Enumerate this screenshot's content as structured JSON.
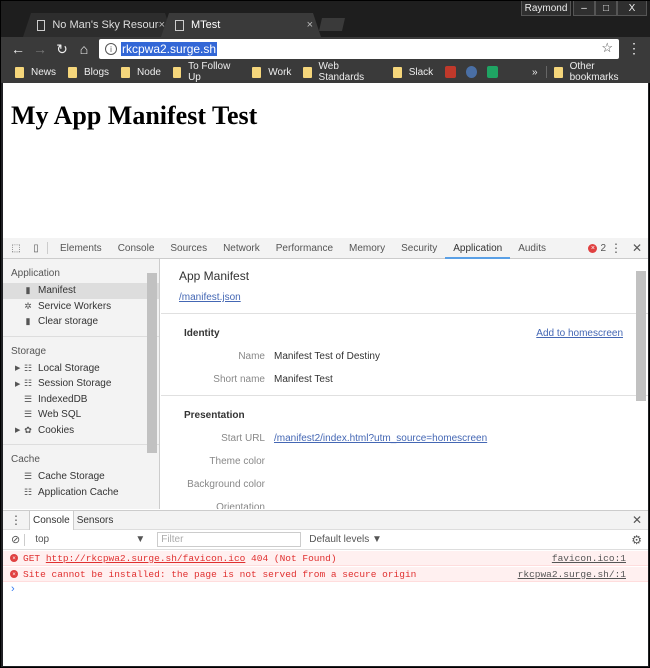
{
  "browser": {
    "tabs": [
      {
        "title": "No Man's Sky Resource",
        "active": false
      },
      {
        "title": "MTest",
        "active": true
      }
    ],
    "profile": "Raymond",
    "window_buttons": {
      "minimize": "‒",
      "maximize": "□",
      "close": "X"
    },
    "url": "rkcpwa2.surge.sh",
    "bookmarks": [
      "News",
      "Blogs",
      "Node",
      "To Follow Up",
      "Work",
      "Web Standards",
      "Slack"
    ],
    "bookmark_icons": [
      {
        "name": "wu-icon",
        "color": "#c0392b"
      },
      {
        "name": "arrow-circle-icon",
        "color": "#4a6fa5"
      },
      {
        "name": "sheets-icon",
        "color": "#1fa463"
      }
    ],
    "overflow": "»",
    "other_bookmarks": "Other bookmarks"
  },
  "page": {
    "heading": "My App Manifest Test"
  },
  "devtools": {
    "tabs": [
      "Elements",
      "Console",
      "Sources",
      "Network",
      "Performance",
      "Memory",
      "Security",
      "Application",
      "Audits"
    ],
    "active_tab": "Application",
    "error_count": "2",
    "sidebar": {
      "sections": [
        {
          "title": "Application",
          "items": [
            {
              "label": "Manifest",
              "icon": "file-icon",
              "glyph": "▮",
              "selected": true
            },
            {
              "label": "Service Workers",
              "icon": "gear-icon",
              "glyph": "✲"
            },
            {
              "label": "Clear storage",
              "icon": "trash-icon",
              "glyph": "▮"
            }
          ]
        },
        {
          "title": "Storage",
          "items": [
            {
              "label": "Local Storage",
              "icon": "grid-icon",
              "glyph": "☷",
              "expandable": true
            },
            {
              "label": "Session Storage",
              "icon": "grid-icon",
              "glyph": "☷",
              "expandable": true
            },
            {
              "label": "IndexedDB",
              "icon": "database-icon",
              "glyph": "☰"
            },
            {
              "label": "Web SQL",
              "icon": "database-icon",
              "glyph": "☰"
            },
            {
              "label": "Cookies",
              "icon": "cookie-icon",
              "glyph": "✿",
              "expandable": true
            }
          ]
        },
        {
          "title": "Cache",
          "items": [
            {
              "label": "Cache Storage",
              "icon": "database-icon",
              "glyph": "☰"
            },
            {
              "label": "Application Cache",
              "icon": "grid-icon",
              "glyph": "☷"
            }
          ]
        }
      ]
    },
    "manifest": {
      "title": "App Manifest",
      "link": "/manifest.json",
      "identity": {
        "title": "Identity",
        "add_to_homescreen": "Add to homescreen",
        "rows": [
          {
            "key": "Name",
            "value": "Manifest Test of Destiny"
          },
          {
            "key": "Short name",
            "value": "Manifest Test"
          }
        ]
      },
      "presentation": {
        "title": "Presentation",
        "rows": [
          {
            "key": "Start URL",
            "value": "/manifest2/index.html?utm_source=homescreen",
            "link": true
          },
          {
            "key": "Theme color",
            "value": ""
          },
          {
            "key": "Background color",
            "value": ""
          },
          {
            "key": "Orientation",
            "value": ""
          }
        ]
      }
    },
    "drawer": {
      "tabs": [
        "Console",
        "Sensors"
      ],
      "context": "top",
      "filter_placeholder": "Filter",
      "levels": "Default levels ▼",
      "messages": [
        {
          "prefix": "GET ",
          "url": "http://rkcpwa2.surge.sh/favicon.ico",
          "suffix": " 404 (Not Found)",
          "source": "favicon.ico:1"
        },
        {
          "prefix": "Site cannot be installed: the page is not served from a secure origin",
          "url": "",
          "suffix": "",
          "source": "rkcpwa2.surge.sh/:1"
        }
      ],
      "prompt": "›"
    }
  }
}
